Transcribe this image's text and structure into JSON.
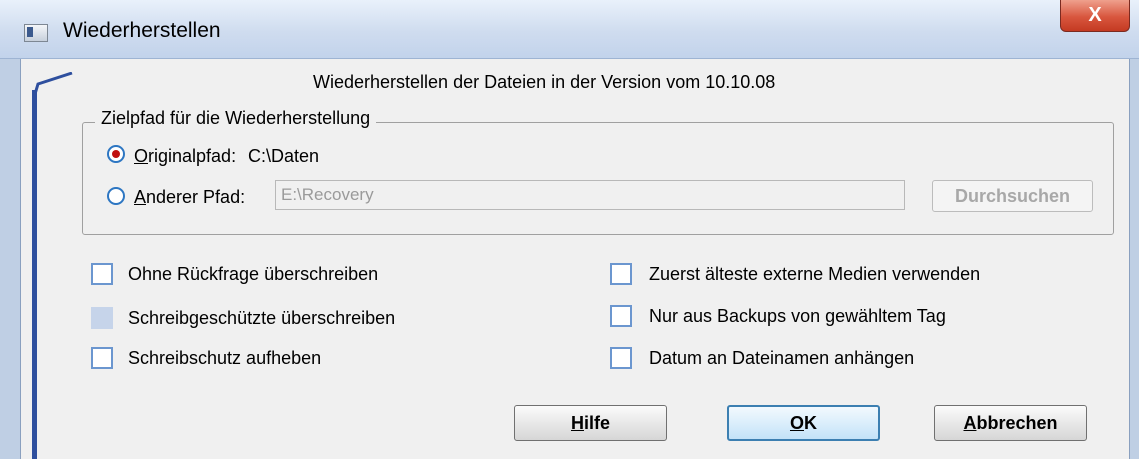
{
  "window": {
    "title": "Wiederherstellen",
    "close_symbol": "X"
  },
  "header": {
    "text": "Wiederherstellen der Dateien in der Version vom 10.10.08"
  },
  "target_group": {
    "legend": "Zielpfad für die Wiederherstellung",
    "original": {
      "label": "Originalpfad:",
      "value": "C:\\Daten",
      "selected": true
    },
    "other": {
      "label": "Anderer Pfad:",
      "value": "E:\\Recovery",
      "selected": false
    },
    "browse_label": "Durchsuchen"
  },
  "options_left": [
    {
      "label": "Ohne Rückfrage überschreiben",
      "checked": false,
      "enabled": true
    },
    {
      "label": "Schreibgeschützte überschreiben",
      "checked": false,
      "enabled": false
    },
    {
      "label": "Schreibschutz aufheben",
      "checked": false,
      "enabled": true
    }
  ],
  "options_right": [
    {
      "label": "Zuerst älteste externe Medien verwenden",
      "checked": false,
      "enabled": true
    },
    {
      "label": "Nur aus Backups von gewähltem Tag",
      "checked": false,
      "enabled": true
    },
    {
      "label": "Datum an Dateinamen anhängen",
      "checked": false,
      "enabled": true
    }
  ],
  "buttons": {
    "help": {
      "mnemonic": "H",
      "rest": "ilfe"
    },
    "ok": {
      "mnemonic": "O",
      "rest": "K"
    },
    "cancel": {
      "mnemonic": "A",
      "rest": "bbrechen"
    }
  },
  "colors": {
    "accent": "#2e4f9e",
    "radio_selected": "#c01010",
    "close_button": "#d8563e"
  }
}
